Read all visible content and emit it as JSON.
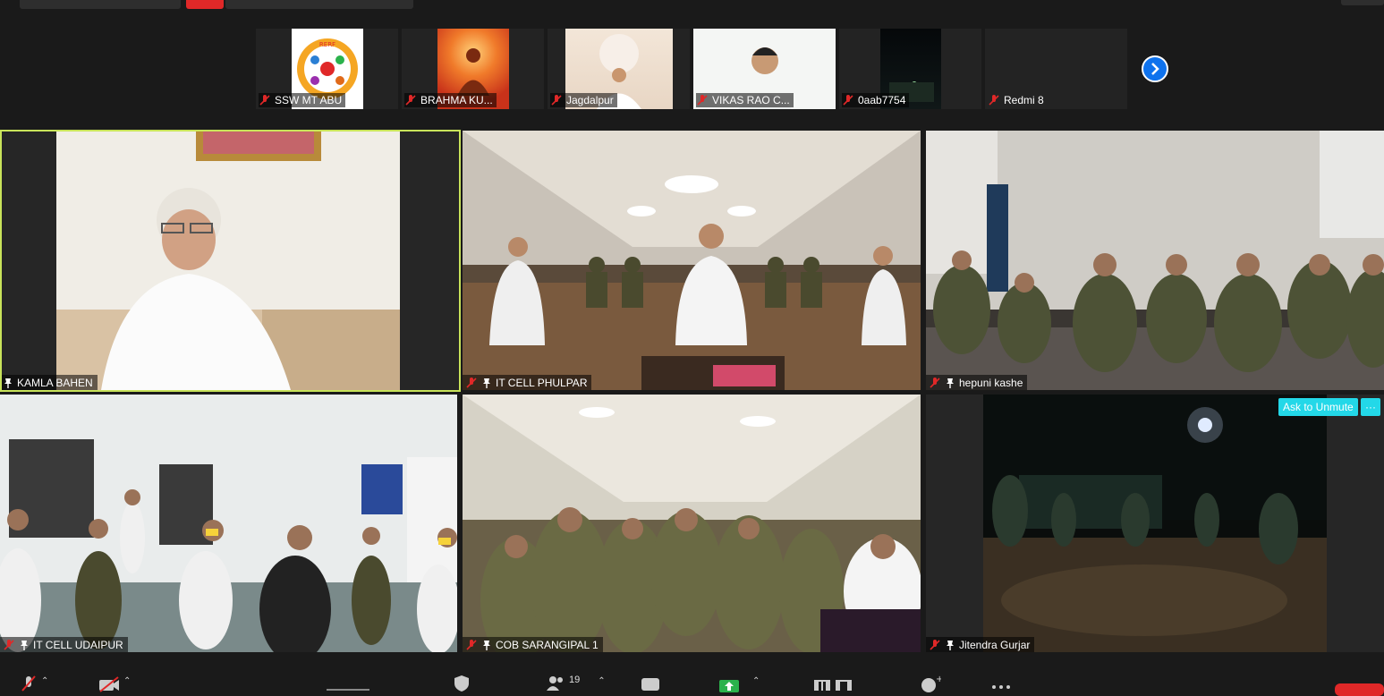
{
  "participants_strip": [
    {
      "name": "SSW MT ABU"
    },
    {
      "name": "BRAHMA KU..."
    },
    {
      "name": "Jagdalpur"
    },
    {
      "name": "VIKAS RAO C..."
    },
    {
      "name": "0aab7754"
    },
    {
      "name": "Redmi 8"
    }
  ],
  "video_tiles": [
    {
      "name": "KAMLA BAHEN"
    },
    {
      "name": "IT CELL PHULPAR"
    },
    {
      "name": "hepuni kashe"
    },
    {
      "name": "IT CELL UDAIPUR"
    },
    {
      "name": "COB SARANGIPAL 1"
    },
    {
      "name": "Jitendra Gurjar"
    }
  ],
  "ask_unmute": {
    "label": "Ask to Unmute",
    "more": "···"
  },
  "toolbar": {
    "participants_count": "19"
  },
  "colors": {
    "accent_blue": "#0e72ed",
    "active_speaker": "#c8e35a",
    "ask_unmute": "#23d8e8",
    "end_red": "#e02828",
    "share_green": "#2bb24c"
  }
}
